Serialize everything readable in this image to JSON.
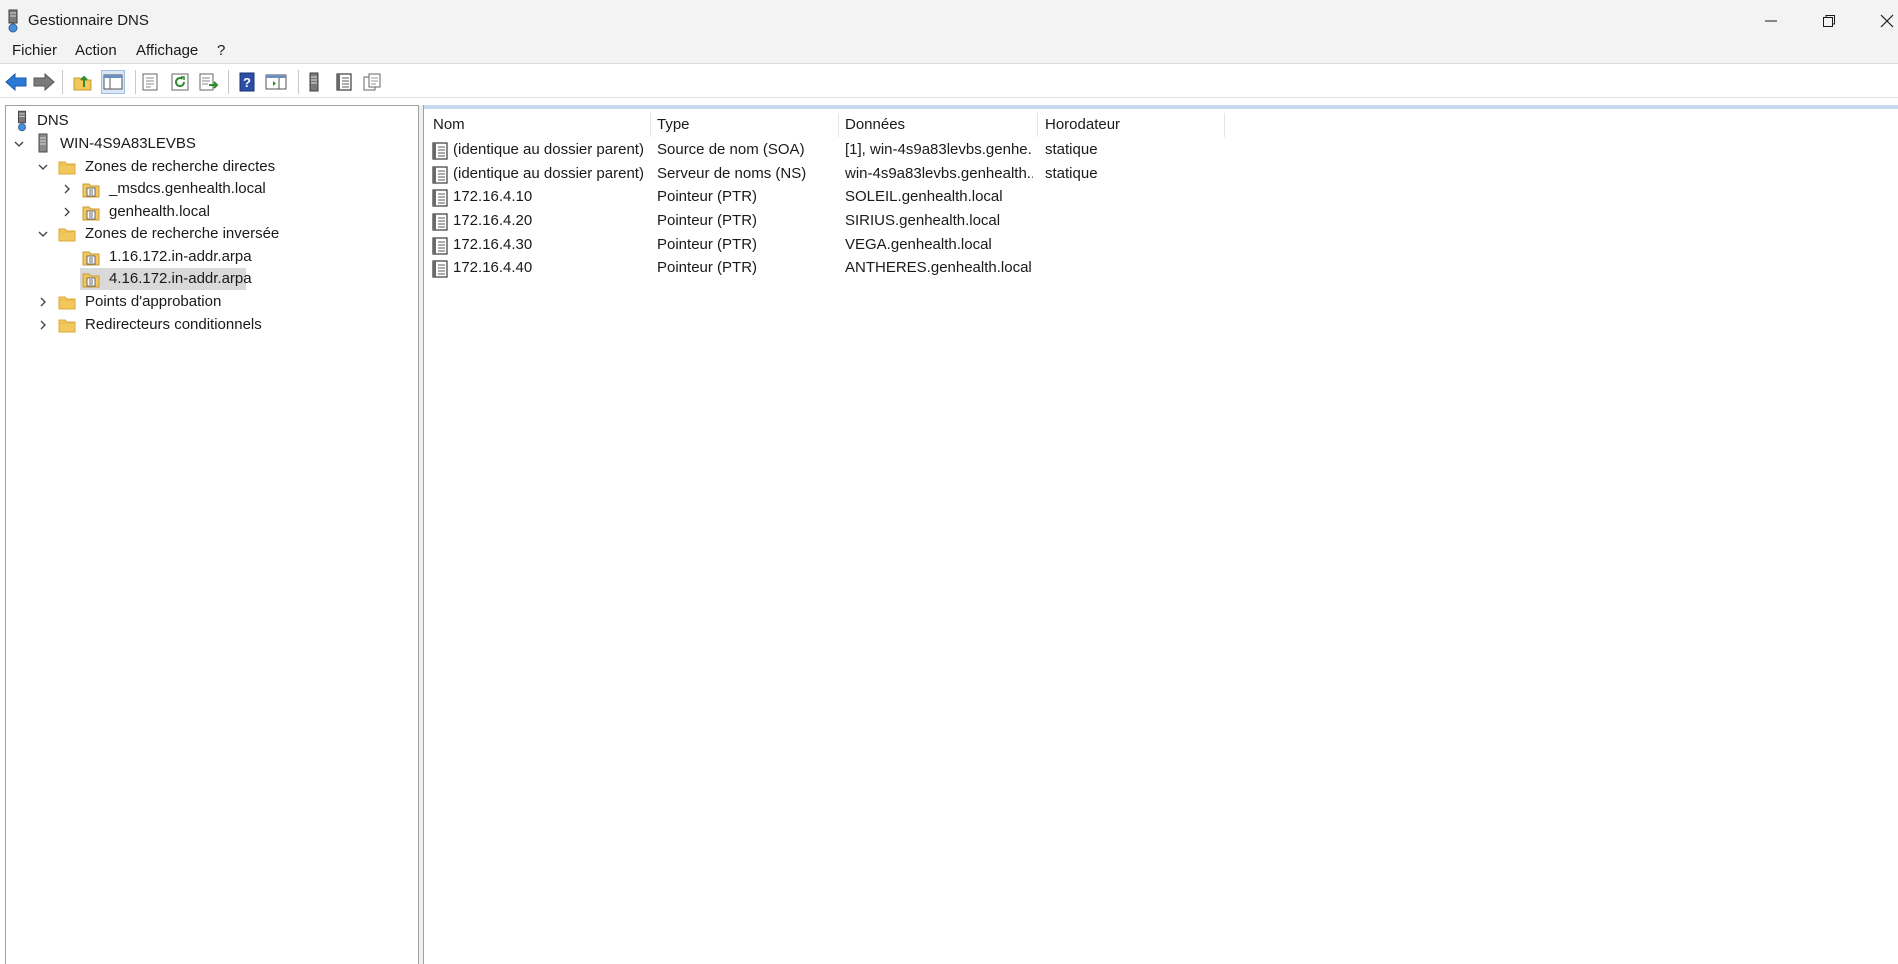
{
  "window": {
    "title": "Gestionnaire DNS",
    "icon": "dns-server-icon"
  },
  "menu": [
    "Fichier",
    "Action",
    "Affichage",
    "?"
  ],
  "toolbar": {
    "buttons": [
      "back-arrow-icon",
      "forward-arrow-icon",
      "up-folder-icon",
      "show-hide-tree-icon",
      "properties-icon",
      "refresh-icon",
      "export-list-icon",
      "help-icon",
      "show-action-pane-icon",
      "server-icon",
      "record-list-icon",
      "copy-icon"
    ]
  },
  "tree": {
    "root": "DNS",
    "server": "WIN-4S9A83LEVBS",
    "forward_zones": "Zones de recherche directes",
    "forward_children": [
      "_msdcs.genhealth.local",
      "genhealth.local"
    ],
    "reverse_zones": "Zones de recherche inversée",
    "reverse_children": [
      "1.16.172.in-addr.arpa",
      "4.16.172.in-addr.arpa"
    ],
    "selected": "4.16.172.in-addr.arpa",
    "trust_points": "Points d'approbation",
    "conditional_forwarders": "Redirecteurs conditionnels"
  },
  "list": {
    "columns": [
      "Nom",
      "Type",
      "Données",
      "Horodateur"
    ],
    "rows": [
      {
        "name": "(identique au dossier parent)",
        "type": "Source de nom (SOA)",
        "data": "[1], win-4s9a83levbs.genhe...",
        "timestamp": "statique"
      },
      {
        "name": "(identique au dossier parent)",
        "type": "Serveur de noms (NS)",
        "data": "win-4s9a83levbs.genhealth...",
        "timestamp": "statique"
      },
      {
        "name": "172.16.4.10",
        "type": "Pointeur (PTR)",
        "data": "SOLEIL.genhealth.local",
        "timestamp": ""
      },
      {
        "name": "172.16.4.20",
        "type": "Pointeur (PTR)",
        "data": "SIRIUS.genhealth.local",
        "timestamp": ""
      },
      {
        "name": "172.16.4.30",
        "type": "Pointeur (PTR)",
        "data": "VEGA.genhealth.local",
        "timestamp": ""
      },
      {
        "name": "172.16.4.40",
        "type": "Pointeur (PTR)",
        "data": "ANTHERES.genhealth.local",
        "timestamp": ""
      }
    ]
  },
  "colors": {
    "selection": "#d9d9d9",
    "folder": "#f2c75c",
    "chrome": "#f3f3f3",
    "accent": "#2b6cc4"
  }
}
